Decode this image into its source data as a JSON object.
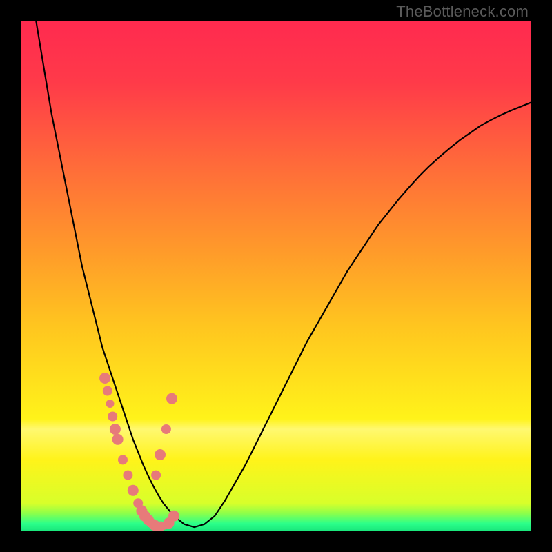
{
  "watermark": "TheBottleneck.com",
  "colors": {
    "frame": "#000000",
    "dot": "#e77a7a",
    "curve": "#000000",
    "gradient_stops": [
      {
        "offset": 0.0,
        "color": "#ff2a4f"
      },
      {
        "offset": 0.12,
        "color": "#ff3a49"
      },
      {
        "offset": 0.28,
        "color": "#ff6a3a"
      },
      {
        "offset": 0.45,
        "color": "#ff9a2a"
      },
      {
        "offset": 0.6,
        "color": "#ffc61f"
      },
      {
        "offset": 0.78,
        "color": "#fff31a"
      },
      {
        "offset": 0.8,
        "color": "#fff870"
      },
      {
        "offset": 0.86,
        "color": "#fff31a"
      },
      {
        "offset": 0.945,
        "color": "#d8ff2a"
      },
      {
        "offset": 0.965,
        "color": "#8dff4a"
      },
      {
        "offset": 0.985,
        "color": "#2bff8a"
      },
      {
        "offset": 1.0,
        "color": "#18e47a"
      }
    ]
  },
  "chart_data": {
    "type": "line",
    "title": "",
    "xlabel": "",
    "ylabel": "",
    "xlim": [
      0,
      100
    ],
    "ylim": [
      0,
      100
    ],
    "x": [
      3,
      4,
      5,
      6,
      7,
      8,
      9,
      10,
      11,
      12,
      13,
      14,
      15,
      16,
      17,
      18,
      19,
      20,
      21,
      22,
      23,
      24,
      25,
      26,
      27,
      28,
      30,
      32,
      34,
      36,
      38,
      40,
      42,
      44,
      46,
      48,
      50,
      52,
      54,
      56,
      58,
      60,
      62,
      64,
      66,
      68,
      70,
      72,
      74,
      76,
      78,
      80,
      82,
      84,
      86,
      88,
      90,
      92,
      94,
      96,
      98,
      100
    ],
    "y": [
      100,
      94,
      88,
      82,
      77,
      72,
      67,
      62,
      57,
      52,
      48,
      44,
      40,
      36,
      33,
      30,
      27,
      24,
      21,
      18,
      15.5,
      13,
      10.8,
      8.8,
      7,
      5.4,
      3,
      1.4,
      0.8,
      1.4,
      3,
      6,
      9.5,
      13,
      17,
      21,
      25,
      29,
      33,
      37,
      40.5,
      44,
      47.5,
      51,
      54,
      57,
      60,
      62.5,
      65,
      67.3,
      69.5,
      71.5,
      73.3,
      75,
      76.6,
      78,
      79.4,
      80.5,
      81.5,
      82.4,
      83.2,
      84
    ],
    "series": [
      {
        "name": "markers",
        "x": [
          16.5,
          17,
          17.5,
          18,
          18.5,
          19,
          20,
          21,
          22,
          23,
          23.7,
          24.3,
          25,
          25.6,
          26.2,
          26.8,
          27.5,
          28,
          29,
          30,
          29.6,
          28.5,
          27.3,
          26.5
        ],
        "y": [
          30,
          27.5,
          25,
          22.5,
          20,
          18,
          14,
          11,
          8,
          5.5,
          4,
          3,
          2.2,
          1.6,
          1.2,
          1,
          1,
          1.1,
          1.6,
          3,
          26,
          20,
          15,
          11
        ],
        "r": [
          8,
          7,
          6,
          7,
          8,
          8,
          7,
          7,
          8,
          7,
          8,
          8,
          8,
          7,
          8,
          7,
          7,
          6,
          8,
          8,
          8,
          7,
          8,
          7
        ]
      }
    ]
  }
}
